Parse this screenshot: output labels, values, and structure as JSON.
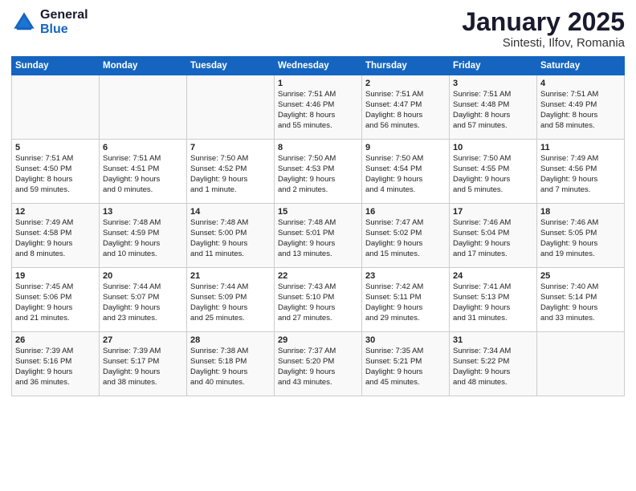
{
  "logo": {
    "general": "General",
    "blue": "Blue"
  },
  "title": "January 2025",
  "subtitle": "Sintesti, Ilfov, Romania",
  "days_of_week": [
    "Sunday",
    "Monday",
    "Tuesday",
    "Wednesday",
    "Thursday",
    "Friday",
    "Saturday"
  ],
  "weeks": [
    [
      {
        "day": "",
        "info": ""
      },
      {
        "day": "",
        "info": ""
      },
      {
        "day": "",
        "info": ""
      },
      {
        "day": "1",
        "info": "Sunrise: 7:51 AM\nSunset: 4:46 PM\nDaylight: 8 hours\nand 55 minutes."
      },
      {
        "day": "2",
        "info": "Sunrise: 7:51 AM\nSunset: 4:47 PM\nDaylight: 8 hours\nand 56 minutes."
      },
      {
        "day": "3",
        "info": "Sunrise: 7:51 AM\nSunset: 4:48 PM\nDaylight: 8 hours\nand 57 minutes."
      },
      {
        "day": "4",
        "info": "Sunrise: 7:51 AM\nSunset: 4:49 PM\nDaylight: 8 hours\nand 58 minutes."
      }
    ],
    [
      {
        "day": "5",
        "info": "Sunrise: 7:51 AM\nSunset: 4:50 PM\nDaylight: 8 hours\nand 59 minutes."
      },
      {
        "day": "6",
        "info": "Sunrise: 7:51 AM\nSunset: 4:51 PM\nDaylight: 9 hours\nand 0 minutes."
      },
      {
        "day": "7",
        "info": "Sunrise: 7:50 AM\nSunset: 4:52 PM\nDaylight: 9 hours\nand 1 minute."
      },
      {
        "day": "8",
        "info": "Sunrise: 7:50 AM\nSunset: 4:53 PM\nDaylight: 9 hours\nand 2 minutes."
      },
      {
        "day": "9",
        "info": "Sunrise: 7:50 AM\nSunset: 4:54 PM\nDaylight: 9 hours\nand 4 minutes."
      },
      {
        "day": "10",
        "info": "Sunrise: 7:50 AM\nSunset: 4:55 PM\nDaylight: 9 hours\nand 5 minutes."
      },
      {
        "day": "11",
        "info": "Sunrise: 7:49 AM\nSunset: 4:56 PM\nDaylight: 9 hours\nand 7 minutes."
      }
    ],
    [
      {
        "day": "12",
        "info": "Sunrise: 7:49 AM\nSunset: 4:58 PM\nDaylight: 9 hours\nand 8 minutes."
      },
      {
        "day": "13",
        "info": "Sunrise: 7:48 AM\nSunset: 4:59 PM\nDaylight: 9 hours\nand 10 minutes."
      },
      {
        "day": "14",
        "info": "Sunrise: 7:48 AM\nSunset: 5:00 PM\nDaylight: 9 hours\nand 11 minutes."
      },
      {
        "day": "15",
        "info": "Sunrise: 7:48 AM\nSunset: 5:01 PM\nDaylight: 9 hours\nand 13 minutes."
      },
      {
        "day": "16",
        "info": "Sunrise: 7:47 AM\nSunset: 5:02 PM\nDaylight: 9 hours\nand 15 minutes."
      },
      {
        "day": "17",
        "info": "Sunrise: 7:46 AM\nSunset: 5:04 PM\nDaylight: 9 hours\nand 17 minutes."
      },
      {
        "day": "18",
        "info": "Sunrise: 7:46 AM\nSunset: 5:05 PM\nDaylight: 9 hours\nand 19 minutes."
      }
    ],
    [
      {
        "day": "19",
        "info": "Sunrise: 7:45 AM\nSunset: 5:06 PM\nDaylight: 9 hours\nand 21 minutes."
      },
      {
        "day": "20",
        "info": "Sunrise: 7:44 AM\nSunset: 5:07 PM\nDaylight: 9 hours\nand 23 minutes."
      },
      {
        "day": "21",
        "info": "Sunrise: 7:44 AM\nSunset: 5:09 PM\nDaylight: 9 hours\nand 25 minutes."
      },
      {
        "day": "22",
        "info": "Sunrise: 7:43 AM\nSunset: 5:10 PM\nDaylight: 9 hours\nand 27 minutes."
      },
      {
        "day": "23",
        "info": "Sunrise: 7:42 AM\nSunset: 5:11 PM\nDaylight: 9 hours\nand 29 minutes."
      },
      {
        "day": "24",
        "info": "Sunrise: 7:41 AM\nSunset: 5:13 PM\nDaylight: 9 hours\nand 31 minutes."
      },
      {
        "day": "25",
        "info": "Sunrise: 7:40 AM\nSunset: 5:14 PM\nDaylight: 9 hours\nand 33 minutes."
      }
    ],
    [
      {
        "day": "26",
        "info": "Sunrise: 7:39 AM\nSunset: 5:16 PM\nDaylight: 9 hours\nand 36 minutes."
      },
      {
        "day": "27",
        "info": "Sunrise: 7:39 AM\nSunset: 5:17 PM\nDaylight: 9 hours\nand 38 minutes."
      },
      {
        "day": "28",
        "info": "Sunrise: 7:38 AM\nSunset: 5:18 PM\nDaylight: 9 hours\nand 40 minutes."
      },
      {
        "day": "29",
        "info": "Sunrise: 7:37 AM\nSunset: 5:20 PM\nDaylight: 9 hours\nand 43 minutes."
      },
      {
        "day": "30",
        "info": "Sunrise: 7:35 AM\nSunset: 5:21 PM\nDaylight: 9 hours\nand 45 minutes."
      },
      {
        "day": "31",
        "info": "Sunrise: 7:34 AM\nSunset: 5:22 PM\nDaylight: 9 hours\nand 48 minutes."
      },
      {
        "day": "",
        "info": ""
      }
    ]
  ]
}
